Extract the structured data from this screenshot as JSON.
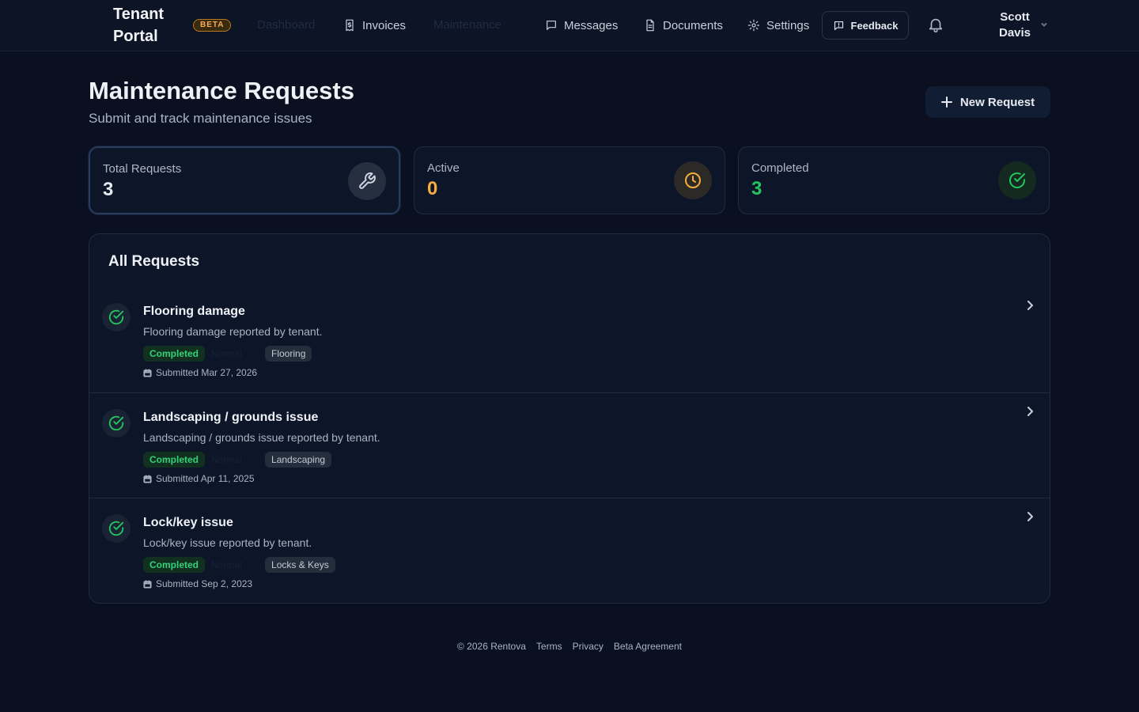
{
  "header": {
    "brand": "Tenant Portal",
    "beta_label": "BETA",
    "ghost_nav": [
      "Dashboard",
      "Maintenance"
    ],
    "nav": [
      {
        "label": "Invoices",
        "icon": "invoice-icon"
      },
      {
        "label": "Messages",
        "icon": "message-icon"
      },
      {
        "label": "Documents",
        "icon": "document-icon"
      },
      {
        "label": "Settings",
        "icon": "gear-icon"
      }
    ],
    "feedback_label": "Feedback",
    "user_name": "Scott Davis"
  },
  "page": {
    "title": "Maintenance Requests",
    "subtitle": "Submit and track maintenance issues",
    "new_request_label": "New Request"
  },
  "stats": [
    {
      "label": "Total Requests",
      "value": "3",
      "color": "#e6e9f0",
      "icon": "wrench-icon",
      "icon_color": "#cfd5df",
      "icon_bg": "#252f40"
    },
    {
      "label": "Active",
      "value": "0",
      "color": "#f6ad3b",
      "icon": "clock-icon",
      "icon_color": "#f6ad3b",
      "icon_bg": "#2c2a26"
    },
    {
      "label": "Completed",
      "value": "3",
      "color": "#22c55e",
      "icon": "check-circle-icon",
      "icon_color": "#22c55e",
      "icon_bg": "#14291f"
    }
  ],
  "requests_panel": {
    "title": "All Requests",
    "items": [
      {
        "title": "Flooring damage",
        "description": "Flooring damage reported by tenant.",
        "status": "Completed",
        "ghost": "Normal",
        "category": "Flooring",
        "submitted": "Submitted Mar 27, 2026"
      },
      {
        "title": "Landscaping / grounds issue",
        "description": "Landscaping / grounds issue reported by tenant.",
        "status": "Completed",
        "ghost": "Normal",
        "category": "Landscaping",
        "submitted": "Submitted Apr 11, 2025"
      },
      {
        "title": "Lock/key issue",
        "description": "Lock/key issue reported by tenant.",
        "status": "Completed",
        "ghost": "Normal",
        "category": "Locks & Keys",
        "submitted": "Submitted Sep 2, 2023"
      }
    ]
  },
  "footer": {
    "copyright": "© 2026 Rentova",
    "links": [
      "Terms",
      "Privacy",
      "Beta Agreement"
    ]
  }
}
